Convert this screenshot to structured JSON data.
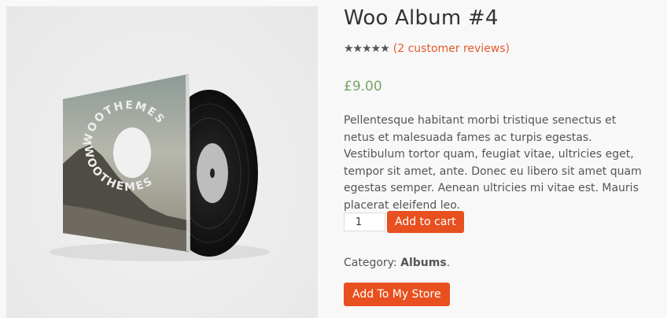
{
  "product": {
    "title": "Woo Album #4",
    "rating_stars": "★★★★★",
    "rating_value": 5,
    "reviews_link": "(2 customer reviews)",
    "price": "£9.00",
    "description": "Pellentesque habitant morbi tristique senectus et netus et malesuada fames ac turpis egestas. Vestibulum tortor quam, feugiat vitae, ultricies eget, tempor sit amet, ante. Donec eu libero sit amet quam egestas semper. Aenean ultricies mi vitae est. Mauris placerat eleifend leo.",
    "quantity": "1",
    "add_to_cart_label": "Add to cart",
    "category_label": "Category:",
    "category_name": "Albums",
    "category_suffix": ".",
    "add_to_store_label": "Add To My Store"
  },
  "album_cover": {
    "logo_text": "WOOTHEMES"
  },
  "colors": {
    "accent": "#e8501f",
    "price": "#77a464",
    "link": "#e55a2b"
  }
}
